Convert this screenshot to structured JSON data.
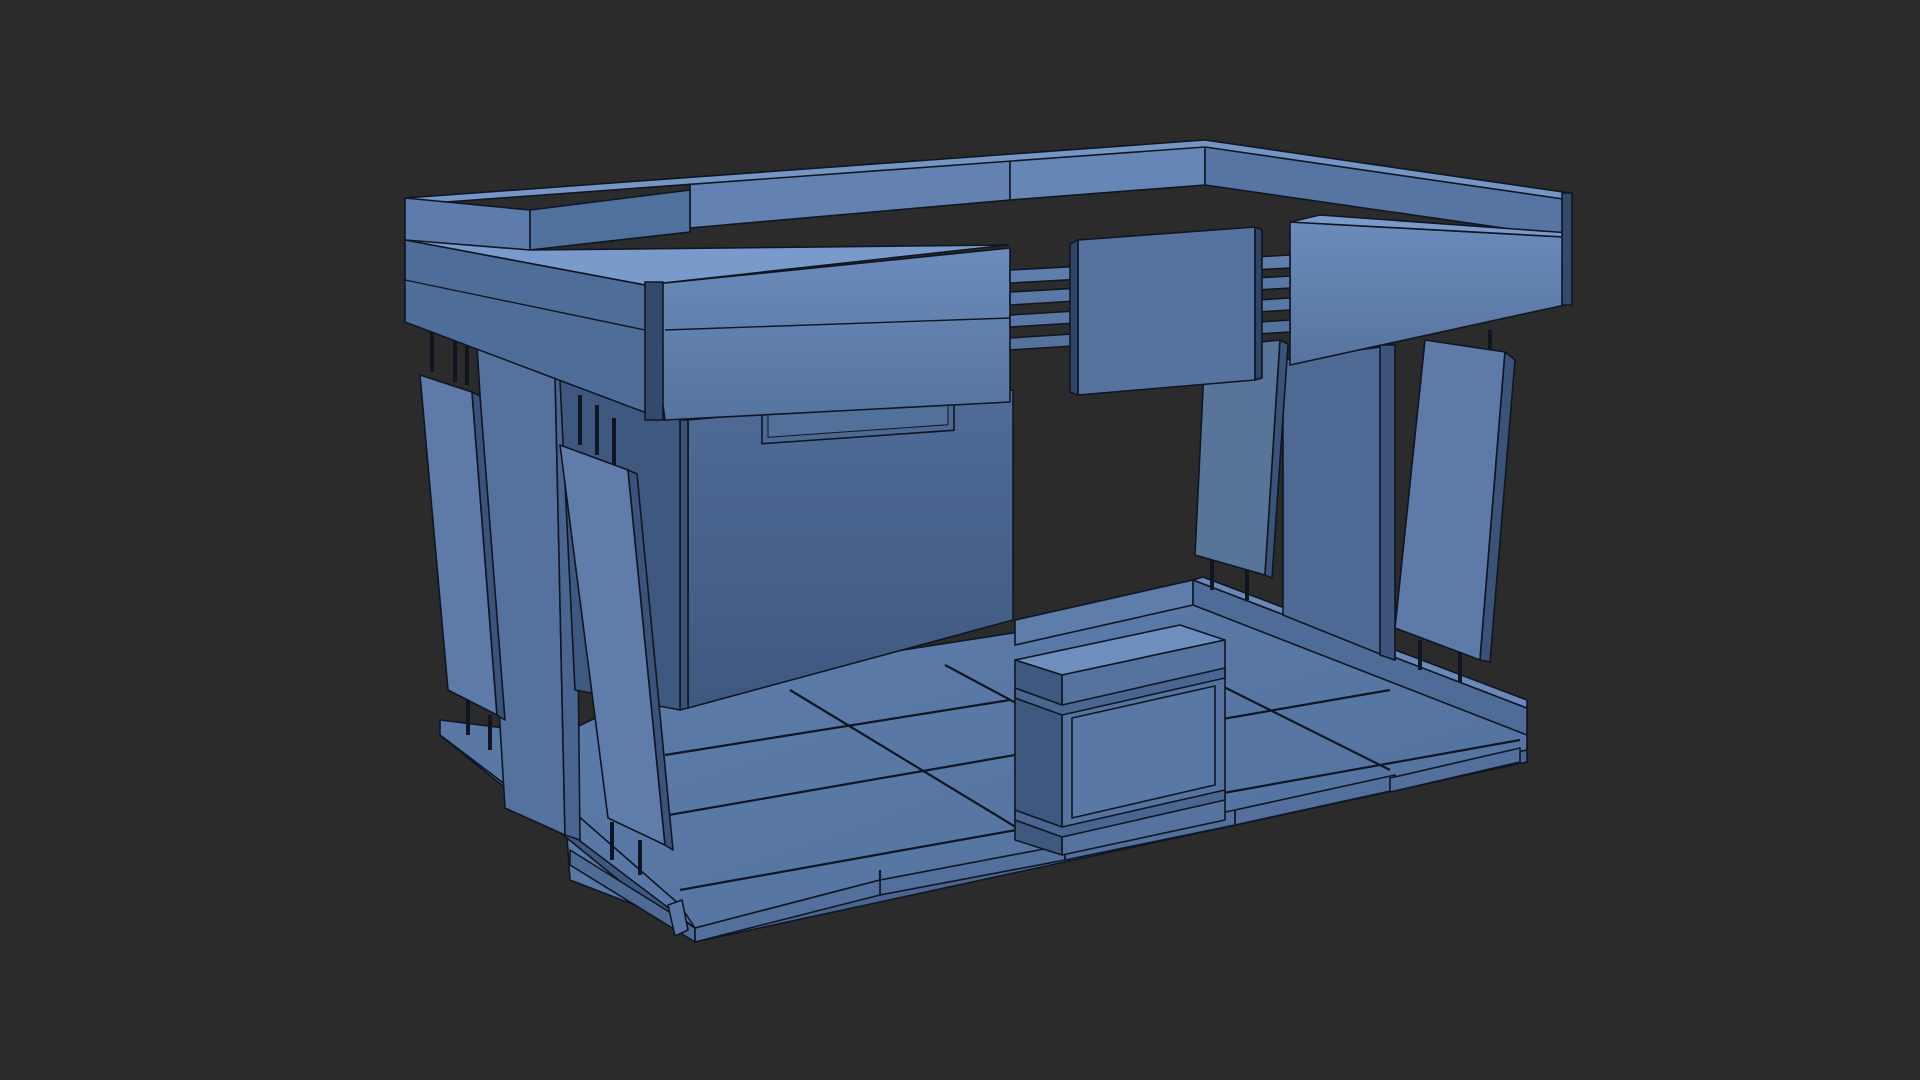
{
  "scene": {
    "background": "#2b2b2b",
    "model": "exhibition-booth",
    "render_style": "wireframe-on-shaded",
    "colors": {
      "top": "#6f8fbd",
      "front": "#5a78a6",
      "side": "#4b6791",
      "dark": "#3b5379",
      "wall": "#4a6590",
      "floor": "#5d7aa6",
      "floor_dark": "#4c6890",
      "edge": "#0f1622"
    }
  }
}
